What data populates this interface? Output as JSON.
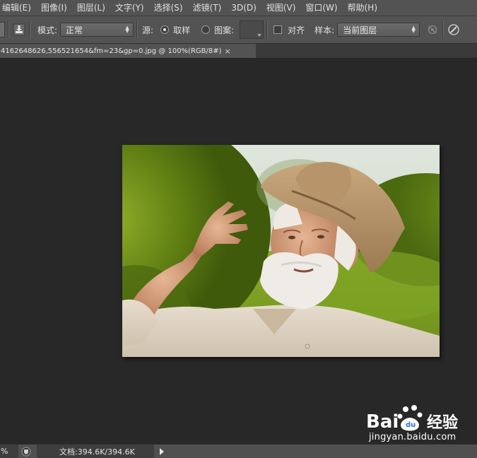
{
  "menubar": {
    "items": [
      {
        "label": "编辑(E)"
      },
      {
        "label": "图像(I)"
      },
      {
        "label": "图层(L)"
      },
      {
        "label": "文字(Y)"
      },
      {
        "label": "选择(S)"
      },
      {
        "label": "滤镜(T)"
      },
      {
        "label": "3D(D)"
      },
      {
        "label": "视图(V)"
      },
      {
        "label": "窗口(W)"
      },
      {
        "label": "帮助(H)"
      }
    ]
  },
  "options": {
    "mode_label": "模式:",
    "mode_value": "正常",
    "source_label": "源:",
    "source_sampled_label": "取样",
    "source_pattern_label": "图案:",
    "align_label": "对齐",
    "sample_label": "样本:",
    "sample_value": "当前图层",
    "source_selected": "sampled",
    "align_checked": false
  },
  "document": {
    "tab_title": "4162648626,556521654&fm=23&gp=0.jpg @ 100%(RGB/8#)",
    "close_glyph": "×"
  },
  "status": {
    "zoom": "%",
    "doc_info": "文档:394.6K/394.6K"
  },
  "watermark": {
    "brand": "Bai du 经验",
    "url": "jingyan.baidu.com"
  },
  "icons": {
    "tool_preset": "brush-preset-icon",
    "clone_source": "clone-source-icon",
    "ignore_adjustment": "ignore-adjustment-layers-icon",
    "pressure": "pressure-brush-icon"
  }
}
